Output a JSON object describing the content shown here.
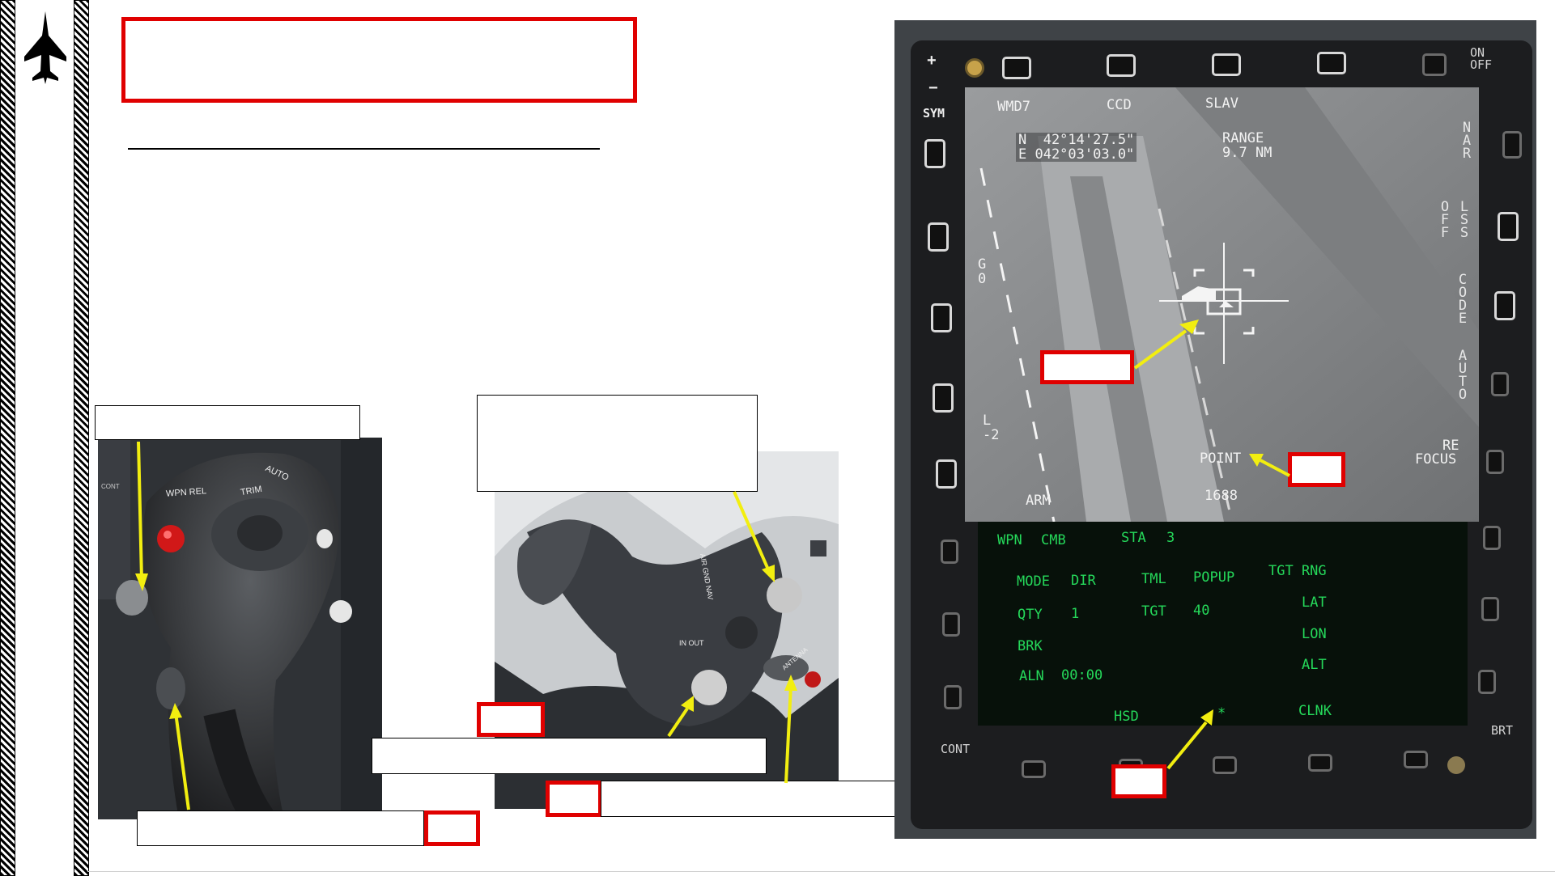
{
  "colors": {
    "highlight_red": "#e00000",
    "arrow_yellow": "#f2ee10",
    "display_green": "#25d85a"
  },
  "icons": {
    "aircraft": "jet-silhouette-icon"
  },
  "stick_photo": {
    "labels": [
      "WPN REL",
      "TRIM",
      "AUTO",
      "CONT"
    ]
  },
  "throttle_photo": {
    "labels": [
      "AIR GND NAV",
      "IN OUT",
      "ANTENNA"
    ]
  },
  "mfd": {
    "bezel": {
      "sym": "SYM",
      "on_off": "ON\nOFF",
      "cont": "CONT",
      "brt": "BRT",
      "plus": "+",
      "minus": "−"
    },
    "top_labels": [
      "WMD7",
      "CCD",
      "SLAV"
    ],
    "coords": {
      "lat": "N  42°14'27.5\"",
      "lon": "E 042°03'03.0\""
    },
    "range": {
      "label": "RANGE",
      "value": "9.7 NM"
    },
    "right_labels": {
      "nar": "NAR",
      "off": "OFF",
      "lss": "LSS",
      "code": "CODE",
      "auto": "AUTO",
      "re": "RE",
      "focus": "FOCUS"
    },
    "left_labels": {
      "g0": "G\n0",
      "l2": "L\n-2",
      "arm": "ARM"
    },
    "point": "POINT",
    "range_num": "1688",
    "wpn_row": {
      "wpn": "WPN",
      "cmb": "CMB",
      "sta": "STA",
      "sta_num": "3"
    },
    "data": {
      "mode": "MODE",
      "dir": "DIR",
      "tml": "TML",
      "popup": "POPUP",
      "tgt_rng": "TGT RNG",
      "qty": "QTY",
      "qty_val": "1",
      "tgt": "TGT",
      "tgt_val": "40",
      "lat": "LAT",
      "lon": "LON",
      "brk": "BRK",
      "alt": "ALT",
      "aln": "ALN",
      "aln_val": "00:00"
    },
    "bottom": {
      "hsd": "HSD",
      "star": "*",
      "clnk": "CLNK"
    }
  }
}
